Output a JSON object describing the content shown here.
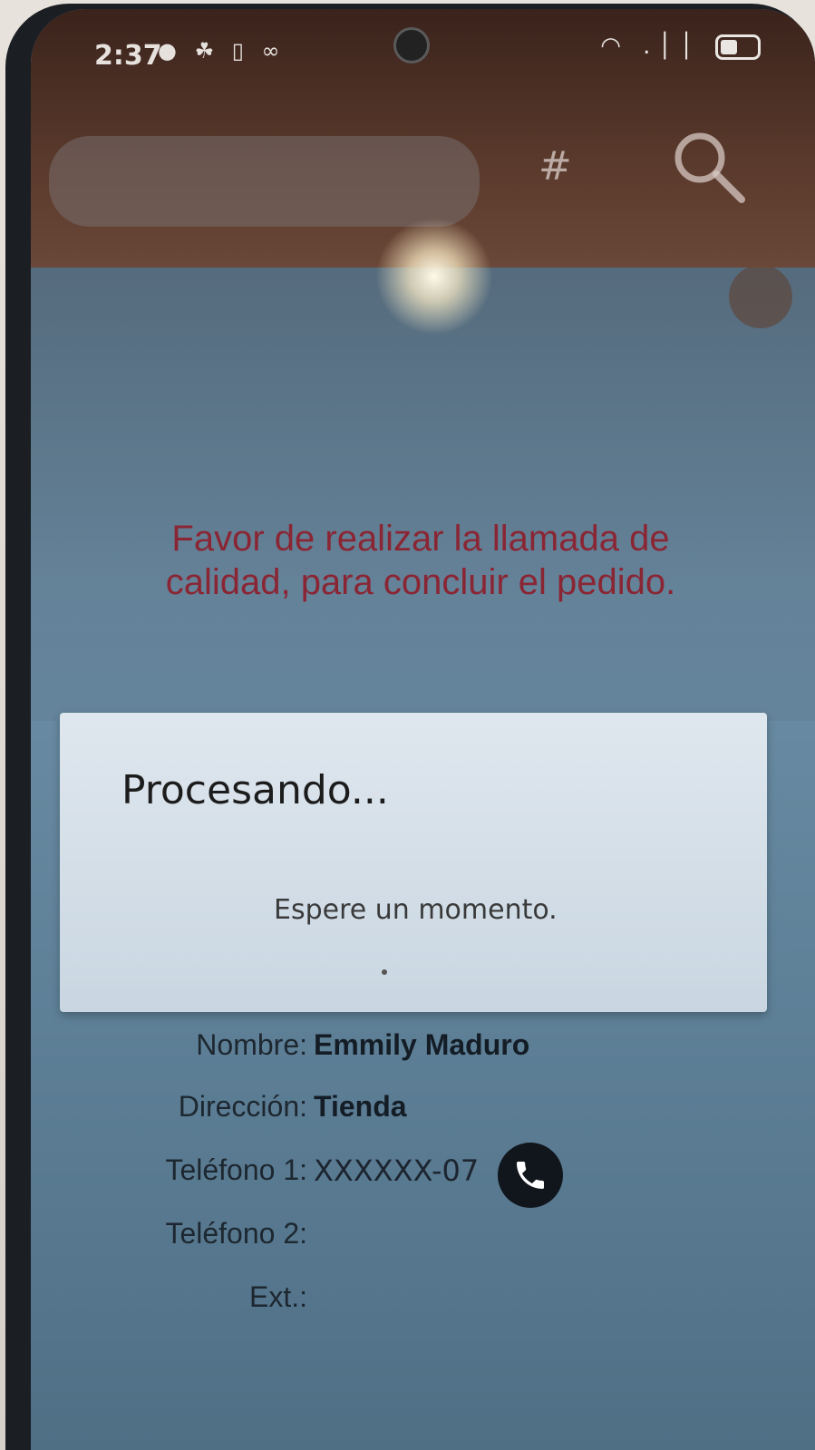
{
  "status_bar": {
    "time": "2:37",
    "left_icons": "● ☘ ▯ ∞",
    "right_icons": "◠ .││"
  },
  "top_bar": {
    "search_placeholder": "",
    "hash_glyph": "#"
  },
  "main": {
    "message": "Favor de realizar la llamada de calidad, para concluir el pedido."
  },
  "dialog": {
    "title": "Procesando...",
    "message": "Espere un momento."
  },
  "customer": {
    "name_label": "Nombre:",
    "name_value": "Emmily Maduro",
    "address_label": "Dirección:",
    "address_value": "Tienda",
    "phone1_label": "Teléfono 1:",
    "phone1_value": "XXXXXX-07",
    "phone2_label": "Teléfono 2:",
    "phone2_value": "",
    "ext_label": "Ext.:",
    "ext_value": ""
  },
  "colors": {
    "message": "#8a2634",
    "dialog_bg": "#dfe7ee",
    "top_band": "#4a2e24",
    "screen_bg": "#6c8ea6",
    "call_button": "#10161c"
  },
  "icons": {
    "search": "search-icon",
    "call": "phone-icon",
    "settings": "settings-icon"
  }
}
